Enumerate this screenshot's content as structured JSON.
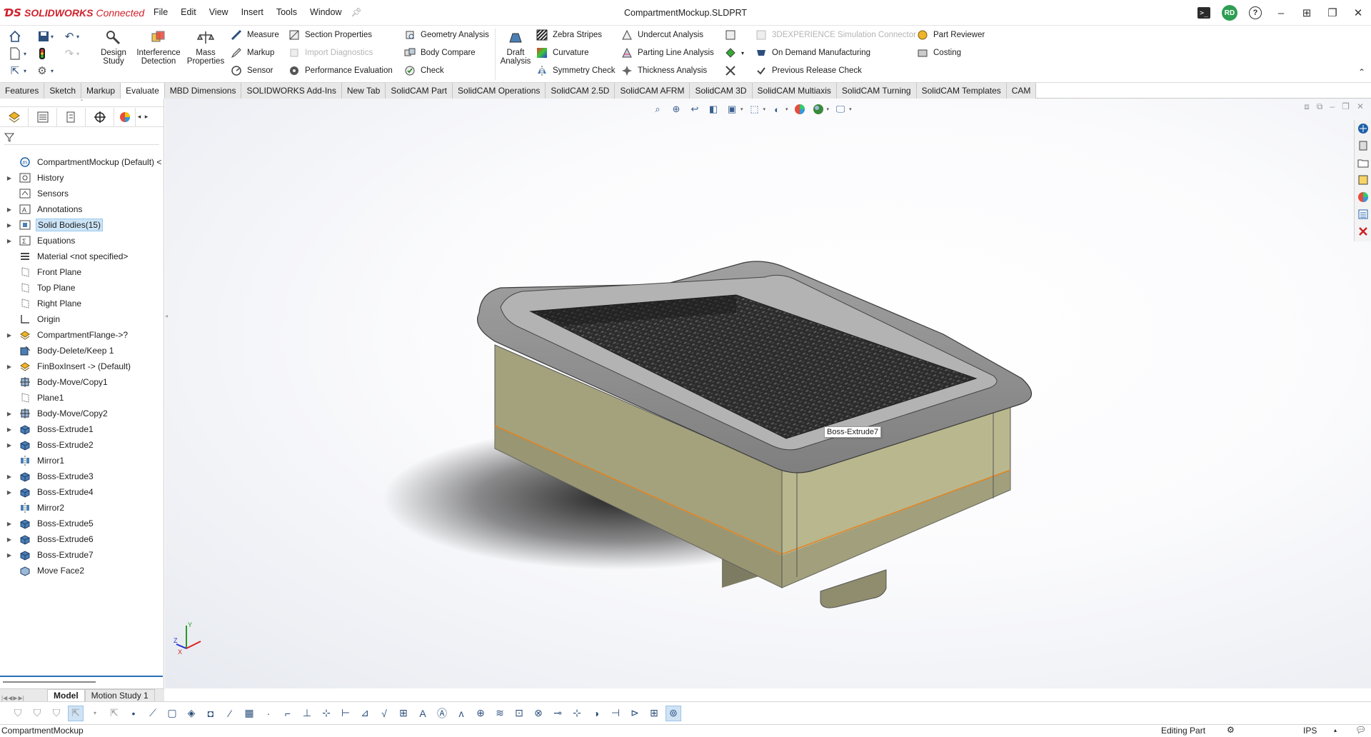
{
  "app": {
    "brand": "SOLIDWORKS",
    "brand_suffix": "Connected",
    "document_title": "CompartmentMockup.SLDPRT",
    "accent_color": "#d0212b",
    "user_initials": "RD"
  },
  "menu": [
    "File",
    "Edit",
    "View",
    "Insert",
    "Tools",
    "Window"
  ],
  "ribbon": {
    "design_study": "Design Study",
    "interference_detection": "Interference Detection",
    "mass_properties": "Mass Properties",
    "measure": "Measure",
    "markup": "Markup",
    "sensor": "Sensor",
    "section_properties": "Section Properties",
    "import_diagnostics": "Import Diagnostics",
    "performance_evaluation": "Performance Evaluation",
    "geometry_analysis": "Geometry Analysis",
    "body_compare": "Body Compare",
    "check": "Check",
    "draft_analysis": "Draft Analysis",
    "zebra_stripes": "Zebra Stripes",
    "curvature": "Curvature",
    "symmetry_check": "Symmetry Check",
    "undercut_analysis": "Undercut Analysis",
    "parting_line_analysis": "Parting Line Analysis",
    "thickness_analysis": "Thickness Analysis",
    "simulation_connector": "3DEXPERIENCE Simulation Connector",
    "on_demand_manufacturing": "On Demand Manufacturing",
    "previous_release_check": "Previous Release Check",
    "part_reviewer": "Part Reviewer",
    "costing": "Costing"
  },
  "tabs": [
    {
      "label": "Features",
      "active": false
    },
    {
      "label": "Sketch",
      "active": false
    },
    {
      "label": "Markup",
      "active": false
    },
    {
      "label": "Evaluate",
      "active": true
    },
    {
      "label": "MBD Dimensions",
      "active": false
    },
    {
      "label": "SOLIDWORKS Add-Ins",
      "active": false
    },
    {
      "label": "New Tab",
      "active": false
    },
    {
      "label": "SolidCAM Part",
      "active": false
    },
    {
      "label": "SolidCAM Operations",
      "active": false
    },
    {
      "label": "SolidCAM 2.5D",
      "active": false
    },
    {
      "label": "SolidCAM AFRM",
      "active": false
    },
    {
      "label": "SolidCAM 3D",
      "active": false
    },
    {
      "label": "SolidCAM Multiaxis",
      "active": false
    },
    {
      "label": "SolidCAM Turning",
      "active": false
    },
    {
      "label": "SolidCAM Templates",
      "active": false
    },
    {
      "label": "CAM",
      "active": false
    }
  ],
  "tree": [
    {
      "label": "CompartmentMockup (Default) <",
      "icon": "part-icon",
      "expander": false,
      "selected": false
    },
    {
      "label": "History",
      "icon": "history-folder-icon",
      "expander": true,
      "selected": false
    },
    {
      "label": "Sensors",
      "icon": "sensor-folder-icon",
      "expander": false,
      "selected": false
    },
    {
      "label": "Annotations",
      "icon": "annotations-folder-icon",
      "expander": true,
      "selected": false
    },
    {
      "label": "Solid Bodies(15)",
      "icon": "solid-bodies-folder-icon",
      "expander": true,
      "selected": true
    },
    {
      "label": "Equations",
      "icon": "equations-folder-icon",
      "expander": true,
      "selected": false
    },
    {
      "label": "Material <not specified>",
      "icon": "material-icon",
      "expander": false,
      "selected": false
    },
    {
      "label": "Front Plane",
      "icon": "plane-icon",
      "expander": false,
      "selected": false
    },
    {
      "label": "Top Plane",
      "icon": "plane-icon",
      "expander": false,
      "selected": false
    },
    {
      "label": "Right Plane",
      "icon": "plane-icon",
      "expander": false,
      "selected": false
    },
    {
      "label": "Origin",
      "icon": "origin-icon",
      "expander": false,
      "selected": false
    },
    {
      "label": "CompartmentFlange->?",
      "icon": "derived-part-icon",
      "expander": true,
      "selected": false
    },
    {
      "label": "Body-Delete/Keep 1",
      "icon": "body-delete-icon",
      "expander": false,
      "selected": false
    },
    {
      "label": "FinBoxInsert -> (Default)",
      "icon": "derived-part-icon",
      "expander": true,
      "selected": false
    },
    {
      "label": "Body-Move/Copy1",
      "icon": "move-copy-icon",
      "expander": false,
      "selected": false
    },
    {
      "label": "Plane1",
      "icon": "plane-icon",
      "expander": false,
      "selected": false
    },
    {
      "label": "Body-Move/Copy2",
      "icon": "move-copy-icon",
      "expander": true,
      "selected": false
    },
    {
      "label": "Boss-Extrude1",
      "icon": "extrude-icon",
      "expander": true,
      "selected": false
    },
    {
      "label": "Boss-Extrude2",
      "icon": "extrude-icon",
      "expander": true,
      "selected": false
    },
    {
      "label": "Mirror1",
      "icon": "mirror-icon",
      "expander": false,
      "selected": false
    },
    {
      "label": "Boss-Extrude3",
      "icon": "extrude-icon",
      "expander": true,
      "selected": false
    },
    {
      "label": "Boss-Extrude4",
      "icon": "extrude-icon",
      "expander": true,
      "selected": false
    },
    {
      "label": "Mirror2",
      "icon": "mirror-icon",
      "expander": false,
      "selected": false
    },
    {
      "label": "Boss-Extrude5",
      "icon": "extrude-icon",
      "expander": true,
      "selected": false
    },
    {
      "label": "Boss-Extrude6",
      "icon": "extrude-icon",
      "expander": true,
      "selected": false
    },
    {
      "label": "Boss-Extrude7",
      "icon": "extrude-icon",
      "expander": true,
      "selected": false
    },
    {
      "label": "Move Face2",
      "icon": "move-face-icon",
      "expander": false,
      "selected": false
    }
  ],
  "bottom_tabs": [
    {
      "label": "Model",
      "active": true
    },
    {
      "label": "Motion Study 1",
      "active": false
    }
  ],
  "viewport": {
    "tooltip": "Boss-Extrude7",
    "triad_x": "X",
    "triad_y": "Y",
    "triad_z": "Z",
    "model_colors": {
      "body": "#b6b48a",
      "flange": "#8e8e8e",
      "mesh": "#3a3a3a",
      "edge_highlight": "#e8801a"
    }
  },
  "status": {
    "document": "CompartmentMockup",
    "mode": "Editing Part",
    "units": "IPS"
  }
}
